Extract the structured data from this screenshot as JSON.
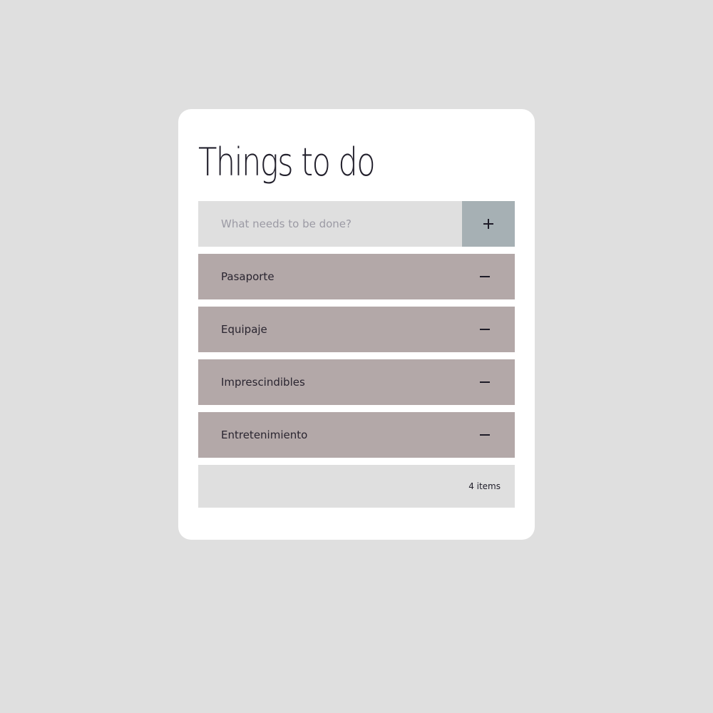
{
  "app": {
    "title": "Things to do"
  },
  "new_todo": {
    "placeholder": "What needs to be done?",
    "value": "",
    "add_icon": "plus-icon"
  },
  "todos": [
    {
      "label": "Pasaporte",
      "remove_icon": "minus-icon"
    },
    {
      "label": "Equipaje",
      "remove_icon": "minus-icon"
    },
    {
      "label": "Imprescindibles",
      "remove_icon": "minus-icon"
    },
    {
      "label": "Entretenimiento",
      "remove_icon": "minus-icon"
    }
  ],
  "footer": {
    "count_text": "4 items"
  },
  "colors": {
    "page_background": "#dfdfdf",
    "card_background": "#ffffff",
    "item_background": "#b3a8a8",
    "add_button_background": "#a6b0b4",
    "text": "#22202c"
  }
}
